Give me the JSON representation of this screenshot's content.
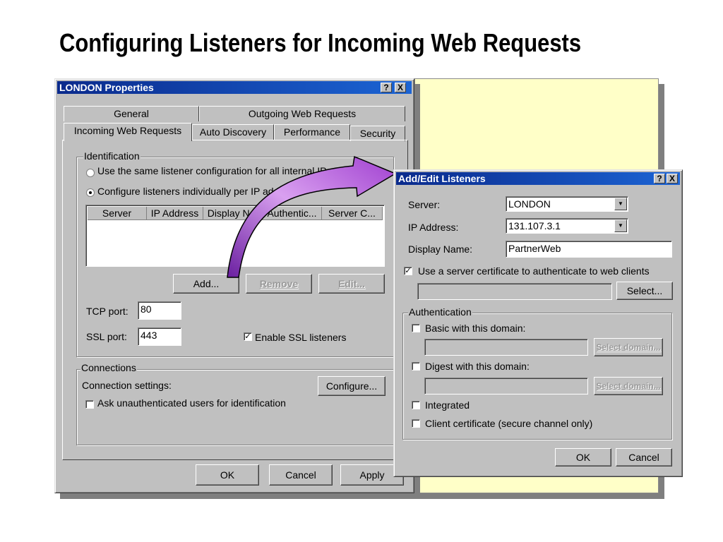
{
  "slide_title": "Configuring Listeners for Incoming Web Requests",
  "london": {
    "title": "LONDON Properties",
    "title_buttons": [
      "?",
      "X"
    ],
    "tabs_back": [
      "General",
      "Outgoing Web Requests"
    ],
    "tabs_front": [
      "Incoming Web Requests",
      "Auto Discovery",
      "Performance",
      "Security"
    ],
    "identification": {
      "legend": "Identification",
      "radio_same": "Use the same listener configuration for all internal IP address",
      "radio_individual": "Configure listeners individually per IP address",
      "columns": [
        "Server",
        "IP Address",
        "Display N...",
        "Authentic...",
        "Server C..."
      ],
      "add_label": "Add...",
      "remove_label": "Remove",
      "edit_label": "Edit...",
      "tcp_label": "TCP port:",
      "tcp_value": "80",
      "ssl_label": "SSL port:",
      "ssl_value": "443",
      "enable_ssl": "Enable SSL listeners"
    },
    "connections": {
      "legend": "Connections",
      "settings_label": "Connection settings:",
      "configure_label": "Configure...",
      "ask_label": "Ask unauthenticated users for identification"
    },
    "ok": "OK",
    "cancel": "Cancel",
    "apply": "Apply"
  },
  "listeners": {
    "title": "Add/Edit Listeners",
    "title_buttons": [
      "?",
      "X"
    ],
    "server_label": "Server:",
    "server_value": "LONDON",
    "ip_label": "IP Address:",
    "ip_value": "131.107.3.1",
    "display_label": "Display Name:",
    "display_value": "PartnerWeb",
    "cert_label": "Use a server certificate to authenticate to web clients",
    "select_label": "Select...",
    "auth": {
      "legend": "Authentication",
      "basic_label": "Basic with this domain:",
      "select_domain_label": "Select domain...",
      "digest_label": "Digest with this domain:",
      "integrated_label": "Integrated",
      "client_cert_label": "Client certificate (secure channel only)"
    },
    "ok": "OK",
    "cancel": "Cancel"
  },
  "colors": {
    "title_bar_start": "#0a2a8c",
    "title_bar_end": "#1c64d4",
    "note_fill": "#ffffc8",
    "arrow_fill": "#c070e0",
    "dialog_face": "#c0c0c0"
  }
}
